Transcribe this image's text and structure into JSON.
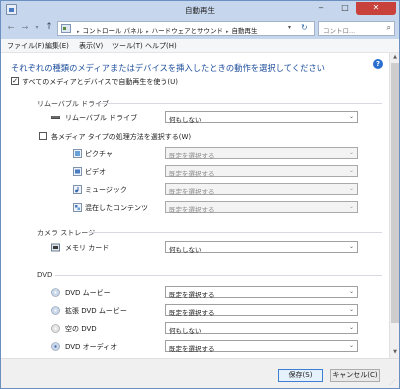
{
  "window": {
    "title": "自動再生"
  },
  "titlebar": {
    "minimize": "‒",
    "maximize": "□",
    "close": "✕"
  },
  "nav": {
    "back": "←",
    "forward": "→",
    "recent": "▾",
    "up": "↑",
    "breadcrumb": [
      "コントロール パネル",
      "ハードウェアとサウンド",
      "自動再生"
    ],
    "separator": "▸",
    "dropdown": "▾",
    "refresh": "↻",
    "search_placeholder": "コントロ...",
    "search_icon": "⌕"
  },
  "menu": [
    "ファイル(F)",
    "編集(E)",
    "表示(V)",
    "ツール(T)",
    "ヘルプ(H)"
  ],
  "main": {
    "heading": "それぞれの種類のメディアまたはデバイスを挿入したときの動作を選択してください",
    "help_label": "?",
    "use_autoplay_label": "すべてのメディアとデバイスで自動再生を使う(U)",
    "use_autoplay_checked": true,
    "checkmark": "✓",
    "removable": {
      "section": "リムーバブル ドライブ",
      "device_label": "リムーバブル ドライブ",
      "device_value": "何もしない",
      "per_type_label": "各メディア タイプの処理方法を選択する(W)",
      "per_type_checked": false,
      "types": [
        {
          "label": "ピクチャ",
          "value": "既定を選択する",
          "icon": "picture-icon"
        },
        {
          "label": "ビデオ",
          "value": "既定を選択する",
          "icon": "video-icon"
        },
        {
          "label": "ミュージック",
          "value": "既定を選択する",
          "icon": "music-icon"
        },
        {
          "label": "混在したコンテンツ",
          "value": "既定を選択する",
          "icon": "mixed-content-icon"
        }
      ]
    },
    "camera": {
      "section": "カメラ ストレージ",
      "device_label": "メモリ カード",
      "device_value": "何もしない"
    },
    "dvd": {
      "section": "DVD",
      "items": [
        {
          "label": "DVD ムービー",
          "value": "既定を選択する"
        },
        {
          "label": "拡張 DVD ムービー",
          "value": "既定を選択する"
        },
        {
          "label": "空の DVD",
          "value": "何もしない"
        },
        {
          "label": "DVD オーディオ",
          "value": "既定を選択する"
        }
      ]
    },
    "select_arrow": "⌄"
  },
  "scrollbar": {
    "up": "▲",
    "down": "▼"
  },
  "footer": {
    "save": "保存(S)",
    "cancel": "キャンセル(C)",
    "grip": "⋰"
  },
  "colors": {
    "accent": "#1e4f9c",
    "close": "#c8413a",
    "chrome": "#c6d6ec"
  }
}
